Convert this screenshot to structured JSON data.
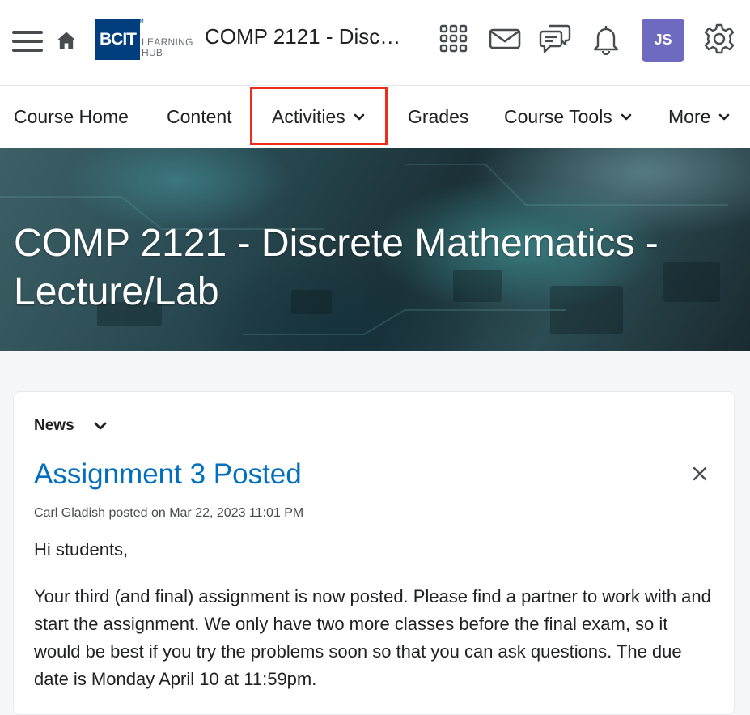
{
  "header": {
    "logo": {
      "mark": "BCIT",
      "line1": "LEARNING",
      "line2": "HUB"
    },
    "course_short": "COMP 2121 - Discr...",
    "avatar_initials": "JS",
    "icons": [
      "menu-icon",
      "home-icon",
      "grid-icon",
      "mail-icon",
      "chat-icon",
      "bell-icon",
      "gear-icon"
    ]
  },
  "nav": {
    "items": [
      {
        "label": "Course Home"
      },
      {
        "label": "Content"
      },
      {
        "label": "Activities",
        "highlighted": true
      },
      {
        "label": "Grades"
      },
      {
        "label": "Course Tools"
      },
      {
        "label": "More"
      }
    ]
  },
  "banner": {
    "title": "COMP 2121 - Discrete Mathematics - Lecture/Lab"
  },
  "news": {
    "heading": "News",
    "item_title": "Assignment 3 Posted",
    "meta": "Carl Gladish posted on Mar 22, 2023 11:01 PM",
    "greeting": "Hi students,",
    "body": "Your third (and final) assignment is now posted. Please find a partner to work with and start the assignment. We only have two more classes before the final exam, so it would be best if you try the problems soon so that you can ask questions.  The due date is Monday April 10 at 11:59pm."
  },
  "colors": {
    "accent_link": "#006fbf",
    "avatar_bg": "#6d6abf",
    "highlight": "#f02d1a",
    "logo_bg": "#003e7e"
  }
}
